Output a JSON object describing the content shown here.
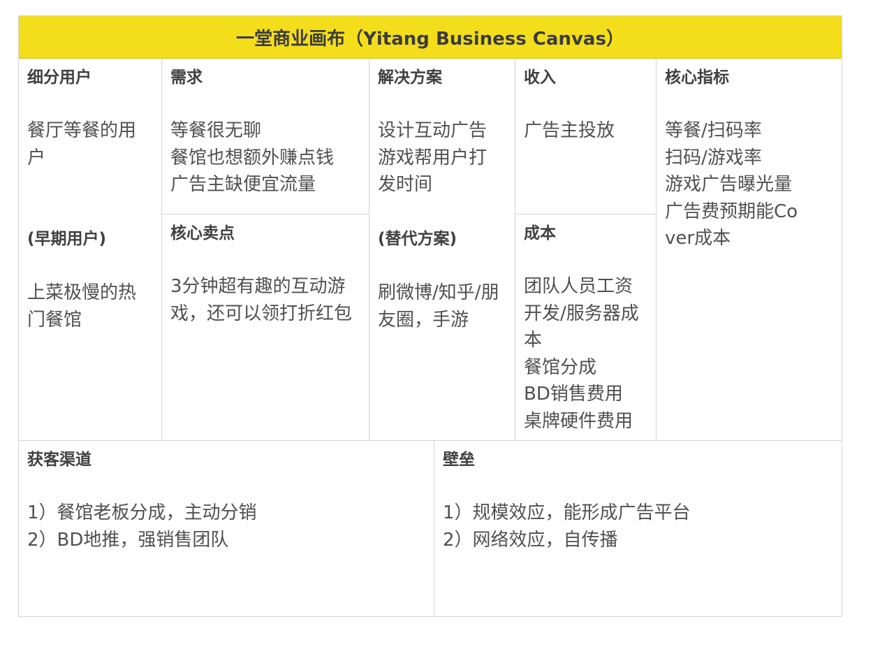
{
  "title": "一堂商业画布（Yitang Business Canvas）",
  "segments": {
    "heading": "细分用户",
    "text": "餐厅等餐的用户",
    "early_heading": "(早期用户)",
    "early_text": "上菜极慢的热门餐馆"
  },
  "needs": {
    "heading": "需求",
    "lines": [
      "等餐很无聊",
      "餐馆也想额外赚点钱",
      "广告主缺便宜流量"
    ]
  },
  "usp": {
    "heading": "核心卖点",
    "text": "3分钟超有趣的互动游戏，还可以领打折红包"
  },
  "solution": {
    "heading": "解决方案",
    "text": "设计互动广告游戏帮用户打发时间",
    "alt_heading": "(替代方案)",
    "alt_text": "刷微博/知乎/朋友圈，手游"
  },
  "revenue": {
    "heading": "收入",
    "text": "广告主投放"
  },
  "cost": {
    "heading": "成本",
    "lines": [
      "团队人员工资",
      "开发/服务器成本",
      "餐馆分成",
      "BD销售费用",
      "桌牌硬件费用"
    ]
  },
  "metrics": {
    "heading": "核心指标",
    "lines": [
      "等餐/扫码率",
      "扫码/游戏率",
      "游戏广告曝光量",
      "广告费预期能Cover成本"
    ]
  },
  "channels": {
    "heading": "获客渠道",
    "lines": [
      "1）餐馆老板分成，主动分销",
      "2）BD地推，强销售团队"
    ]
  },
  "barrier": {
    "heading": "壁垒",
    "lines": [
      "1）规模效应，能形成广告平台",
      "2）网络效应，自传播"
    ]
  }
}
